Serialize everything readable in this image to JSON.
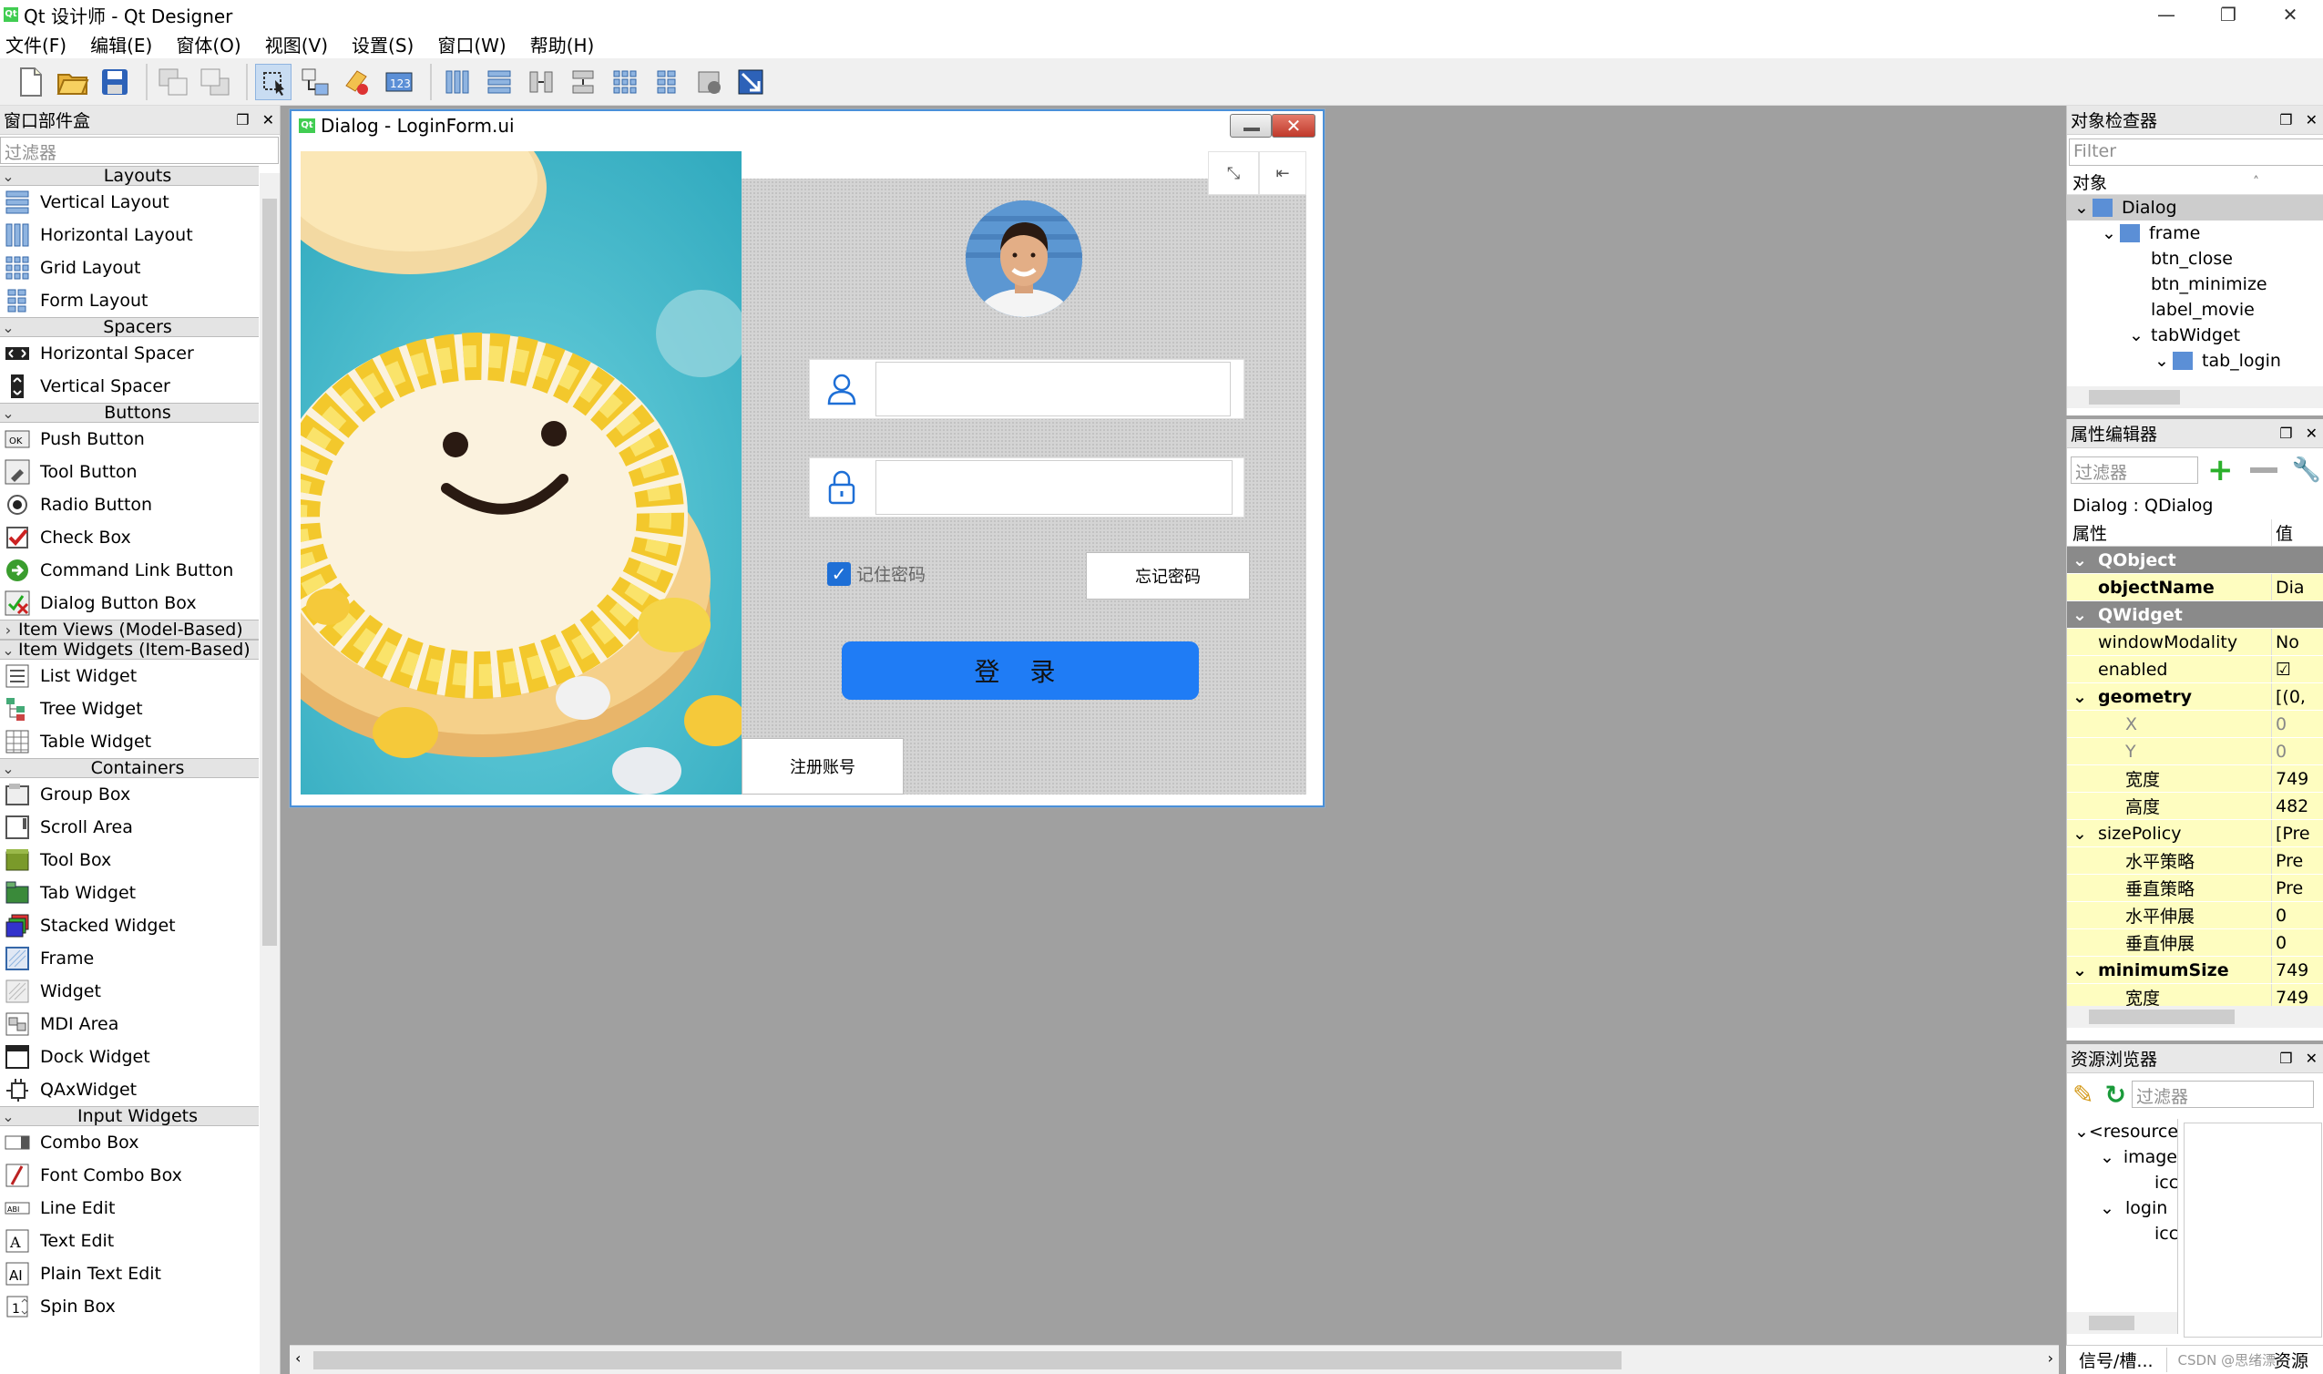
{
  "app": {
    "title": "Qt 设计师 - Qt Designer",
    "qt_logo": "Qt"
  },
  "window_controls": {
    "minimize": "—",
    "maximize": "❐",
    "close": "✕"
  },
  "menu": [
    "文件(F)",
    "编辑(E)",
    "窗体(O)",
    "视图(V)",
    "设置(S)",
    "窗口(W)",
    "帮助(H)"
  ],
  "widget_box": {
    "title": "窗口部件盒",
    "filter_placeholder": "过滤器",
    "categories": {
      "layouts": "Layouts",
      "spacers": "Spacers",
      "buttons": "Buttons",
      "item_views": "Item Views (Model-Based)",
      "item_widgets": "Item Widgets (Item-Based)",
      "containers": "Containers",
      "input_widgets": "Input Widgets"
    },
    "layouts": [
      "Vertical Layout",
      "Horizontal Layout",
      "Grid Layout",
      "Form Layout"
    ],
    "spacers": [
      "Horizontal Spacer",
      "Vertical Spacer"
    ],
    "buttons": [
      "Push Button",
      "Tool Button",
      "Radio Button",
      "Check Box",
      "Command Link Button",
      "Dialog Button Box"
    ],
    "item_widgets": [
      "List Widget",
      "Tree Widget",
      "Table Widget"
    ],
    "containers": [
      "Group Box",
      "Scroll Area",
      "Tool Box",
      "Tab Widget",
      "Stacked Widget",
      "Frame",
      "Widget",
      "MDI Area",
      "Dock Widget",
      "QAxWidget"
    ],
    "input_widgets": [
      "Combo Box",
      "Font Combo Box",
      "Line Edit",
      "Text Edit",
      "Plain Text Edit",
      "Spin Box"
    ]
  },
  "form": {
    "title": "Dialog - LoginForm.ui",
    "remember_label": "记住密码",
    "forgot_label": "忘记密码",
    "login_label": "登 录",
    "register_label": "注册账号"
  },
  "object_inspector": {
    "title": "对象检查器",
    "filter_placeholder": "Filter",
    "column_header": "对象",
    "tree": [
      "Dialog",
      "frame",
      "btn_close",
      "btn_minimize",
      "label_movie",
      "tabWidget",
      "tab_login"
    ]
  },
  "property_editor": {
    "title": "属性编辑器",
    "filter_placeholder": "过滤器",
    "class_label": "Dialog : QDialog",
    "col_property": "属性",
    "col_value": "值",
    "rows": [
      {
        "name": "QObject",
        "value": ""
      },
      {
        "name": "objectName",
        "value": "Dia"
      },
      {
        "name": "QWidget",
        "value": ""
      },
      {
        "name": "windowModality",
        "value": "No"
      },
      {
        "name": "enabled",
        "value": "☑"
      },
      {
        "name": "geometry",
        "value": "[(0,"
      },
      {
        "name": "X",
        "value": "0"
      },
      {
        "name": "Y",
        "value": "0"
      },
      {
        "name": "宽度",
        "value": "749"
      },
      {
        "name": "高度",
        "value": "482"
      },
      {
        "name": "sizePolicy",
        "value": "[Pre"
      },
      {
        "name": "水平策略",
        "value": "Pre"
      },
      {
        "name": "垂直策略",
        "value": "Pre"
      },
      {
        "name": "水平伸展",
        "value": "0"
      },
      {
        "name": "垂直伸展",
        "value": "0"
      },
      {
        "name": "minimumSize",
        "value": "749"
      },
      {
        "name": "宽度",
        "value": "749"
      }
    ]
  },
  "resource_browser": {
    "title": "资源浏览器",
    "filter_placeholder": "过滤器",
    "tree": [
      "<resource",
      "image",
      "icc",
      "login",
      "icc"
    ]
  },
  "bottom_tabs": {
    "signals": "信号/槽...",
    "resources": "资源"
  },
  "watermark": "CSDN @思绪漂"
}
